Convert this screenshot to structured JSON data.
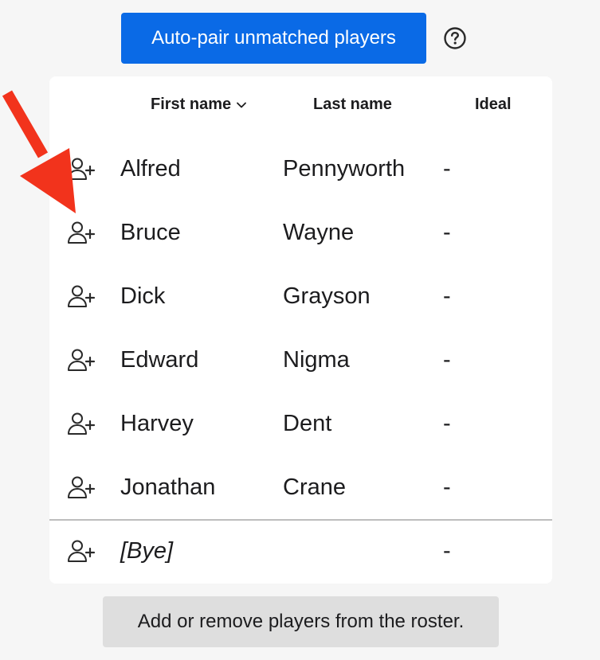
{
  "toolbar": {
    "autopair_label": "Auto-pair unmatched players"
  },
  "table": {
    "headers": {
      "first_name": "First name",
      "last_name": "Last name",
      "ideal": "Ideal"
    },
    "sort": {
      "column": "first_name",
      "direction": "descending-chevron"
    },
    "rows": [
      {
        "first": "Alfred",
        "last": "Pennyworth",
        "ideal": "-"
      },
      {
        "first": "Bruce",
        "last": "Wayne",
        "ideal": "-"
      },
      {
        "first": "Dick",
        "last": "Grayson",
        "ideal": "-"
      },
      {
        "first": "Edward",
        "last": "Nigma",
        "ideal": "-"
      },
      {
        "first": "Harvey",
        "last": "Dent",
        "ideal": "-"
      },
      {
        "first": "Jonathan",
        "last": "Crane",
        "ideal": "-"
      }
    ],
    "bye_row": {
      "first": "[Bye]",
      "last": "",
      "ideal": "-"
    }
  },
  "footer": {
    "roster_label": "Add or remove players from the roster."
  },
  "icons": {
    "row_action": "user-plus-icon",
    "help": "question-circle-icon",
    "sort": "chevron-down-icon",
    "annotation": "red-arrow"
  },
  "colors": {
    "primary": "#0a6ae6",
    "annotation": "#f2331c"
  }
}
